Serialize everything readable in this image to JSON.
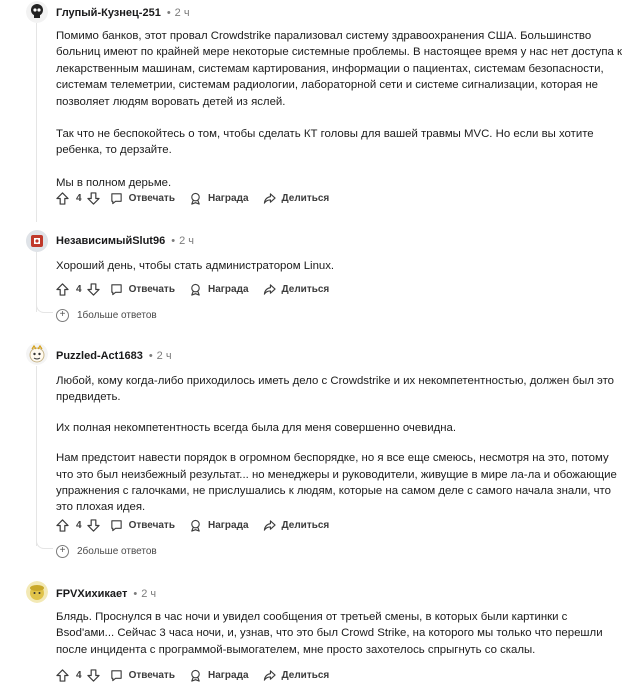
{
  "comments": [
    {
      "author": "Глупый-Кузнец-251",
      "time": "2 ч",
      "paragraphs": [
        "Помимо банков, этот провал Crowdstrike парализовал систему здравоохранения США. Большинство больниц имеют по крайней мере некоторые системные проблемы. В настоящее время у нас нет доступа к лекарственным машинам, системам картирования, информации о пациентах, системам безопасности, системам телеметрии, системам радиологии, лабораторной сети и системе сигнализации, которая не позволяет людям воровать детей из яслей.",
        "Так что не беспокойтесь о том, чтобы сделать КТ головы для вашей травмы MVC. Но если вы хотите ребенка, то дерзайте.",
        "Мы в полном дерьме."
      ],
      "votes": "4",
      "reply_label": "Отвечать",
      "award_label": "Награда",
      "share_label": "Делиться"
    },
    {
      "author": "НезависимыйSlut96",
      "time": "2 ч",
      "paragraphs": [
        "Хороший день, чтобы стать администратором Linux."
      ],
      "votes": "4",
      "reply_label": "Отвечать",
      "award_label": "Награда",
      "share_label": "Делиться",
      "more_replies": "1больше ответов"
    },
    {
      "author": "Puzzled-Act1683",
      "time": "2 ч",
      "paragraphs": [
        "Любой, кому когда-либо приходилось иметь дело с Crowdstrike и их некомпетентностью, должен был это предвидеть.",
        "Их полная некомпетентность всегда была для меня совершенно очевидна.",
        "Нам предстоит навести порядок в огромном беспорядке, но я все еще смеюсь, несмотря на это, потому что это был неизбежный результат... но менеджеры и руководители, живущие в мире ла-ла и обожающие упражнения с галочками, не прислушались к людям, которые на самом деле с самого начала знали, что это плохая идея."
      ],
      "votes": "4",
      "reply_label": "Отвечать",
      "award_label": "Награда",
      "share_label": "Делиться",
      "more_replies": "2больше ответов"
    },
    {
      "author": "FPVXихикает",
      "time": "2 ч",
      "paragraphs": [
        "Блядь. Проснулся в час ночи и увидел сообщения от третьей смены, в которых были картинки с Bsod'ами... Сейчас 3 часа ночи, и, узнав, что это был Crowd Strike, на которого мы только что перешли после инцидента с программой-вымогателем, мне просто захотелось спрыгнуть со скалы."
      ],
      "votes": "4",
      "reply_label": "Отвечать",
      "award_label": "Награда",
      "share_label": "Делиться"
    }
  ],
  "separator": "•",
  "more_symbol": "+"
}
